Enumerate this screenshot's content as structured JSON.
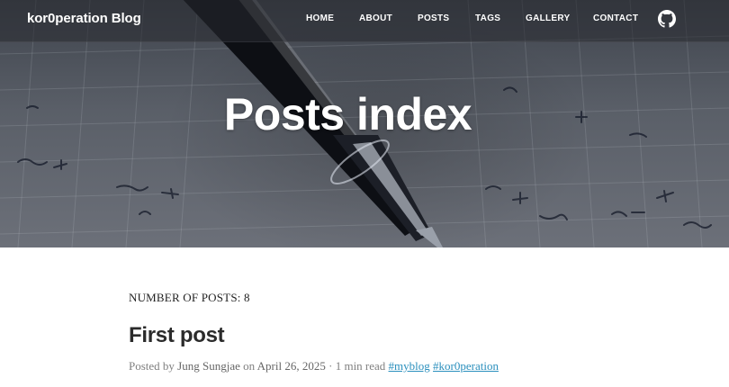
{
  "brand": "kor0peration Blog",
  "nav": [
    {
      "label": "HOME"
    },
    {
      "label": "ABOUT"
    },
    {
      "label": "POSTS"
    },
    {
      "label": "TAGS"
    },
    {
      "label": "GALLERY"
    },
    {
      "label": "CONTACT"
    }
  ],
  "github_icon": "github-icon",
  "hero": {
    "title": "Posts index"
  },
  "posts_count_label": "NUMBER OF POSTS: 8",
  "post": {
    "title": "First post",
    "posted_by": "Posted by",
    "author": "Jung Sungjae",
    "on": "on",
    "date": "April 26, 2025",
    "read_time": "· 1 min read",
    "tags": [
      "#myblog",
      "#kor0peration"
    ]
  }
}
